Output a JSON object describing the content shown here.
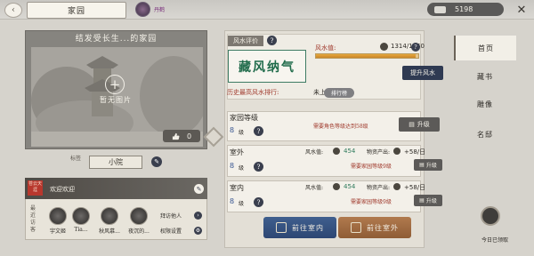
{
  "header": {
    "title": "家园",
    "player_name": "丹鹤",
    "coins": "5198"
  },
  "showcase": {
    "title": "结发受长生...的家园",
    "no_photo": "暂无图片",
    "likes": "0"
  },
  "yard": {
    "label": "标签",
    "name": "小院"
  },
  "visitors": {
    "seal_text": "苍云天涯",
    "welcome": "欢迎欢迎",
    "recent_label": "最近访客",
    "list": [
      "宇文姬",
      "Tia...",
      "秋风慕...",
      "夜沉的..."
    ],
    "visit_others": "拜访他人",
    "permissions": "权限设置"
  },
  "fengshui": {
    "title": "风水评价",
    "name": "藏风纳气",
    "value_label": "风水值:",
    "value": "1314/1350",
    "progress": 0.973,
    "upgrade_button": "提升风水",
    "history_label": "历史最高风水排行:",
    "history_value": "未上",
    "rank_button": "排行榜"
  },
  "home_level": {
    "name": "家园等级",
    "level": "8",
    "unit": "级",
    "requirement": "需要角色等级达到58级",
    "upgrade": "升级"
  },
  "outdoor": {
    "name": "室外",
    "level": "8",
    "unit": "级",
    "fs_label": "风水值:",
    "fs_value": "454",
    "prod_label": "物资产出:",
    "prod_value": "+58/日",
    "requirement": "需要家园等级9级",
    "upgrade": "升级"
  },
  "indoor": {
    "name": "室内",
    "level": "8",
    "unit": "级",
    "fs_label": "风水值:",
    "fs_value": "454",
    "prod_label": "物资产出:",
    "prod_value": "+58/日",
    "requirement": "需要家园等级9级",
    "upgrade": "升级"
  },
  "actions": {
    "go_indoor": "前往室内",
    "go_outdoor": "前往室外"
  },
  "nav": {
    "items": [
      "首页",
      "藏书",
      "雕像",
      "名邸"
    ]
  },
  "claim": {
    "label": "今日已领取"
  }
}
